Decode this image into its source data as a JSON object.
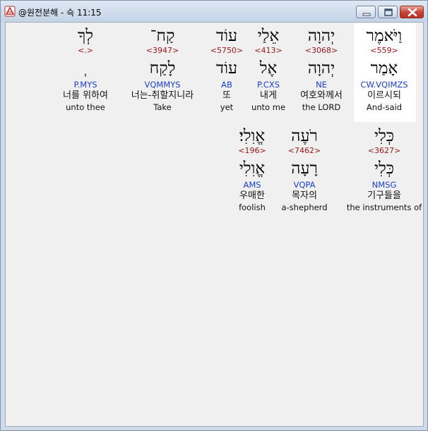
{
  "window": {
    "title": "@원전분해 - 슥 11:15"
  },
  "icons": {
    "app": "bible-app-icon",
    "minimize": "minimize-icon",
    "maximize": "maximize-icon",
    "close": "close-icon"
  },
  "row1": [
    {
      "hebrew": "וַיֹּאמֶר",
      "strong": "<559>",
      "lemma": "אָמַר",
      "morph": "CW.VQIMZS",
      "korean": "이르시되",
      "english": "And-said"
    },
    {
      "hebrew": "יְהוָה",
      "strong": "<3068>",
      "lemma": "יְהוָה",
      "morph": "NE",
      "korean": "여호와께서",
      "english": "the LORD"
    },
    {
      "hebrew": "אֵלַי",
      "strong": "<413>",
      "lemma": "אֶל",
      "morph": "P.CXS",
      "korean": "내게",
      "english": "unto me"
    },
    {
      "hebrew": "עוֹד",
      "strong": "<5750>",
      "lemma": "עוֹד",
      "morph": "AB",
      "korean": "또",
      "english": "yet"
    },
    {
      "hebrew": "קַח־",
      "strong": "<3947>",
      "lemma": "לָקַח",
      "morph": "VQMMYS",
      "korean": "너는-취할지니라",
      "english": "Take"
    },
    {
      "hebrew": "לְךָ",
      "strong": "<.>",
      "lemma": "ְ",
      "morph": "P.MYS",
      "korean": "너를 위하여",
      "english": "unto thee"
    }
  ],
  "row2": [
    {
      "hebrew": "כְּלִי",
      "strong": "<3627>",
      "lemma": "כְּלִי",
      "morph": "NMSG",
      "korean": "기구들을",
      "english": "the instruments of"
    },
    {
      "hebrew": "רֹעֶה",
      "strong": "<7462>",
      "lemma": "רָעָה",
      "morph": "VQPA",
      "korean": "목자의",
      "english": "a-shepherd"
    },
    {
      "hebrew": "אֱוִלִי׃",
      "strong": "<196>",
      "lemma": "אֱוִלִי",
      "morph": "AMS",
      "korean": "우매한",
      "english": "foolish"
    }
  ]
}
